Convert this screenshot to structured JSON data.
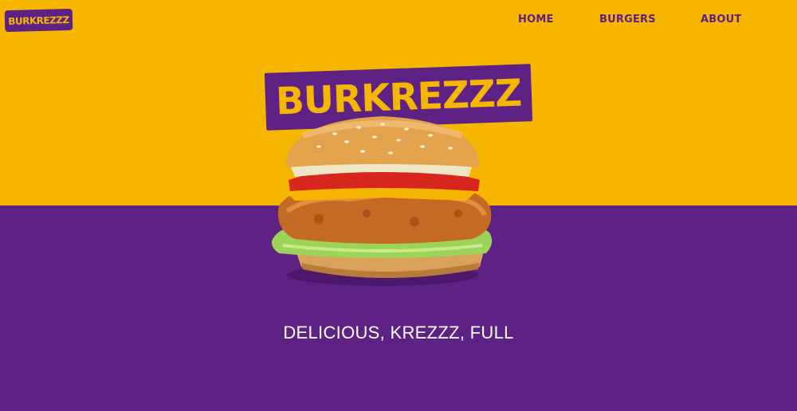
{
  "brand": {
    "logo_text": "BURKREZZZ",
    "hero_text": "BURKREZZZ"
  },
  "nav": {
    "items": [
      {
        "label": "HOME"
      },
      {
        "label": "BURGERS"
      },
      {
        "label": "ABOUT"
      }
    ]
  },
  "hero": {
    "image_icon": "burger-image",
    "tagline": "DELICIOUS, KREZZZ, FULL"
  },
  "colors": {
    "yellow": "#F6B600",
    "purple": "#5E2184",
    "white": "#FFFFFF"
  }
}
